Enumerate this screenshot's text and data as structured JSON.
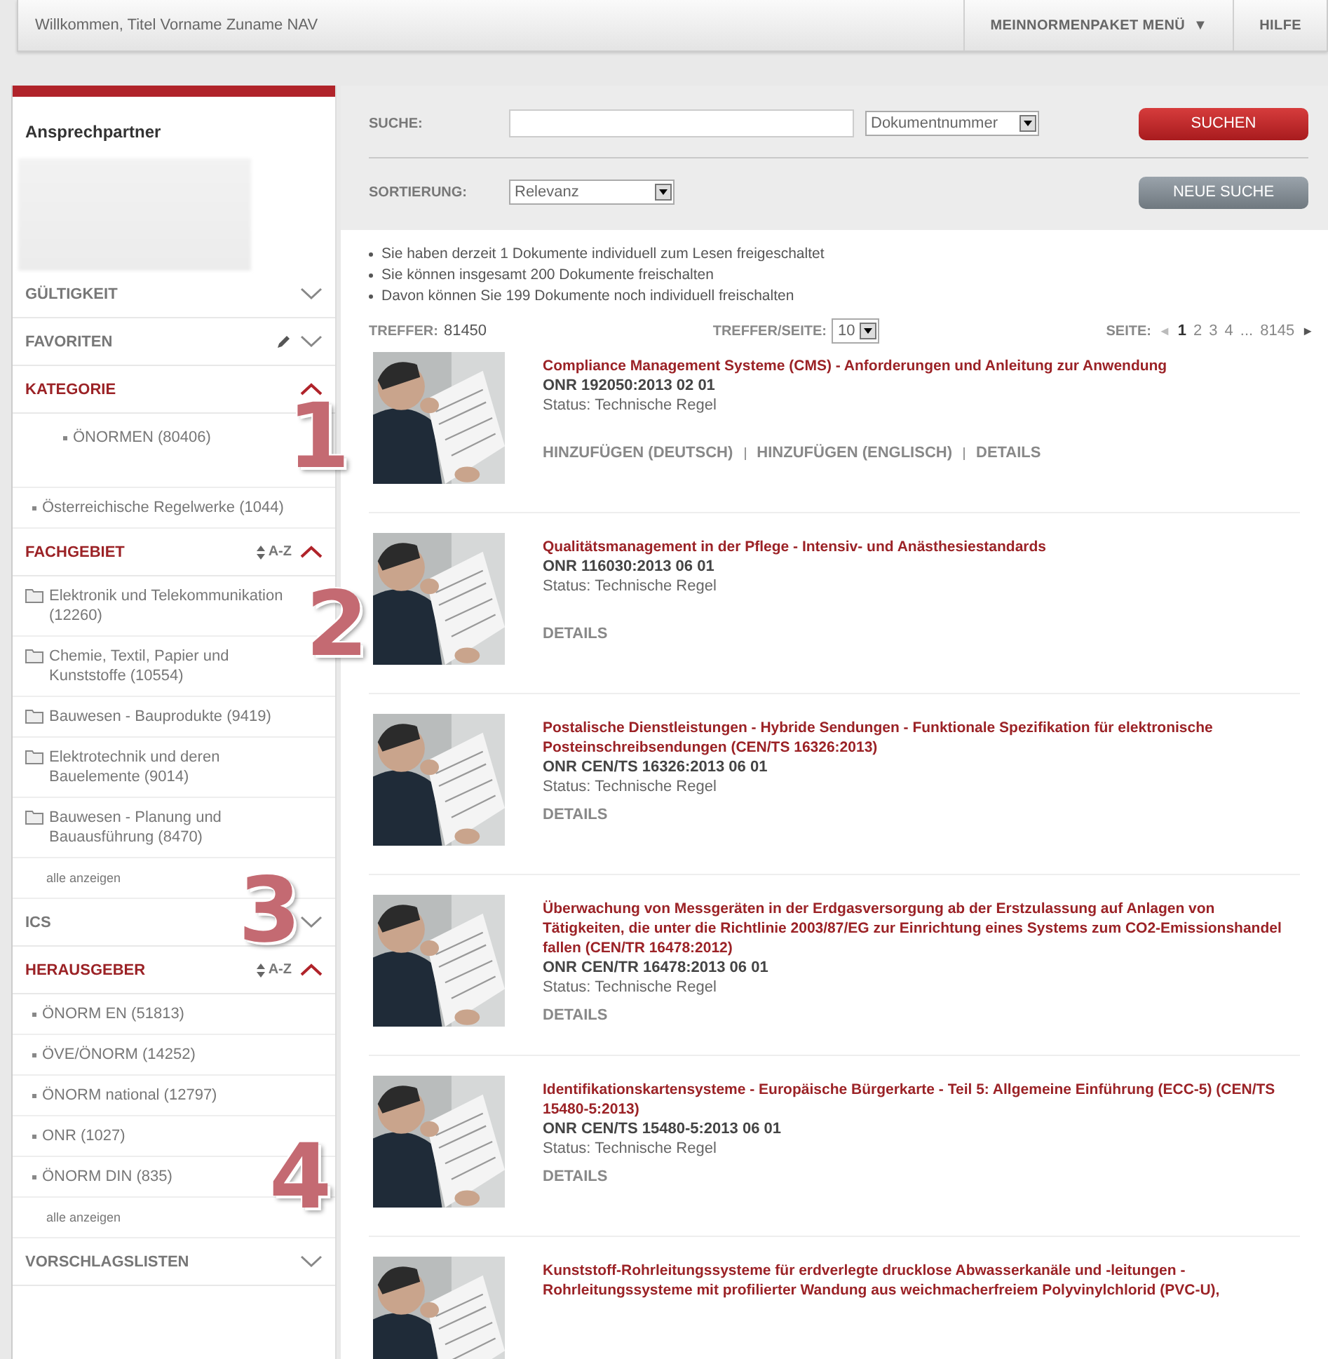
{
  "top_bar": {
    "welcome": "Willkommen, Titel Vorname Zuname NAV",
    "menu": [
      {
        "label": "MEINNORMENPAKET MENÜ",
        "caret": "▼"
      },
      {
        "label": "HILFE"
      }
    ]
  },
  "sidebar": {
    "contact_title": "Ansprechpartner",
    "sections": [
      {
        "title": "GÜLTIGKEIT",
        "expanded": false
      },
      {
        "title": "FAVORITEN",
        "expanded": false,
        "editable": true
      },
      {
        "title": "KATEGORIE",
        "expanded": true,
        "items": [
          {
            "kind": "sub",
            "label": "ÖNORMEN (80406)"
          },
          {
            "kind": "bullet",
            "label": "Österreichische Regelwerke (1044)"
          }
        ]
      },
      {
        "title": "FACHGEBIET",
        "expanded": true,
        "sort_label": "A-Z",
        "items": [
          {
            "kind": "folder",
            "label": "Elektronik und Telekommunikation (12260)"
          },
          {
            "kind": "folder",
            "label": "Chemie, Textil, Papier und Kunststoffe (10554)"
          },
          {
            "kind": "folder",
            "label": "Bauwesen - Bauprodukte (9419)"
          },
          {
            "kind": "folder",
            "label": "Elektrotechnik und deren Bauelemente (9014)"
          },
          {
            "kind": "folder",
            "label": "Bauwesen - Planung und Bauausführung (8470)"
          },
          {
            "kind": "more",
            "label": "alle anzeigen"
          }
        ]
      },
      {
        "title": "ICS",
        "expanded": false
      },
      {
        "title": "HERAUSGEBER",
        "expanded": true,
        "sort_label": "A-Z",
        "items": [
          {
            "kind": "bullet",
            "label": "ÖNORM EN (51813)"
          },
          {
            "kind": "bullet",
            "label": "ÖVE/ÖNORM (14252)"
          },
          {
            "kind": "bullet",
            "label": "ÖNORM national (12797)"
          },
          {
            "kind": "bullet",
            "label": "ONR (1027)"
          },
          {
            "kind": "bullet",
            "label": "ÖNORM DIN (835)"
          },
          {
            "kind": "more",
            "label": "alle anzeigen"
          }
        ]
      },
      {
        "title": "VORSCHLAGSLISTEN",
        "expanded": false
      }
    ]
  },
  "search": {
    "label": "SUCHE:",
    "field_type": "Dokumentnummer",
    "button": "SUCHEN",
    "sort_label": "SORTIERUNG:",
    "sort_value": "Relevanz",
    "new_search": "NEUE SUCHE"
  },
  "notes": [
    "Sie haben derzeit 1 Dokumente individuell zum Lesen freigeschaltet",
    "Sie können insgesamt 200 Dokumente freischalten",
    "Davon können Sie 199 Dokumente noch individuell freischalten"
  ],
  "results_bar": {
    "hits_label": "TREFFER:",
    "hits": "81450",
    "per_page_label": "TREFFER/SEITE:",
    "per_page": "10",
    "page_label": "SEITE:",
    "prev": "◄",
    "pages": [
      {
        "label": "1",
        "selected": true
      },
      {
        "label": "2",
        "selected": false
      },
      {
        "label": "3",
        "selected": false
      },
      {
        "label": "4",
        "selected": false
      },
      {
        "label": "...",
        "selected": false
      },
      {
        "label": "8145",
        "selected": false
      }
    ],
    "next": "►"
  },
  "results": [
    {
      "title": "Compliance Management Systeme (CMS) - Anforderungen und Anleitung zur Anwendung",
      "number": "ONR 192050:2013 02 01",
      "status": "Status: Technische Regel",
      "actions": [
        "HINZUFÜGEN (DEUTSCH)",
        "HINZUFÜGEN (ENGLISCH)",
        "DETAILS"
      ]
    },
    {
      "title": "Qualitätsmanagement in der Pflege - Intensiv- und Anästhesiestandards",
      "number": "ONR 116030:2013 06 01",
      "status": "Status: Technische Regel",
      "actions": [
        "DETAILS"
      ]
    },
    {
      "title": "Postalische Dienstleistungen - Hybride Sendungen - Funktionale Spezifikation für elektronische Posteinschreibsendungen (CEN/TS 16326:2013)",
      "number": "ONR CEN/TS 16326:2013 06 01",
      "status": "Status: Technische Regel",
      "actions": [
        "DETAILS"
      ]
    },
    {
      "title": "Überwachung von Messgeräten in der Erdgasversorgung ab der Erstzulassung auf Anlagen von Tätigkeiten, die unter die Richtlinie 2003/87/EG zur Einrichtung eines Systems zum CO2-Emissionshandel fallen (CEN/TR 16478:2012)",
      "number": "ONR CEN/TR 16478:2013 06 01",
      "status": "Status: Technische Regel",
      "actions": [
        "DETAILS"
      ]
    },
    {
      "title": "Identifikationskartensysteme - Europäische Bürgerkarte - Teil 5: Allgemeine Einführung (ECC-5) (CEN/TS 15480-5:2013)",
      "number": "ONR CEN/TS 15480-5:2013 06 01",
      "status": "Status: Technische Regel",
      "actions": [
        "DETAILS"
      ]
    },
    {
      "title": "Kunststoff-Rohrleitungssysteme für erdverlegte drucklose Abwasserkanäle und -leitungen - Rohrleitungssysteme mit profilierter Wandung aus weichmacherfreiem Polyvinylchlorid (PVC-U),"
    }
  ],
  "callouts": [
    "1",
    "2",
    "3",
    "4"
  ]
}
